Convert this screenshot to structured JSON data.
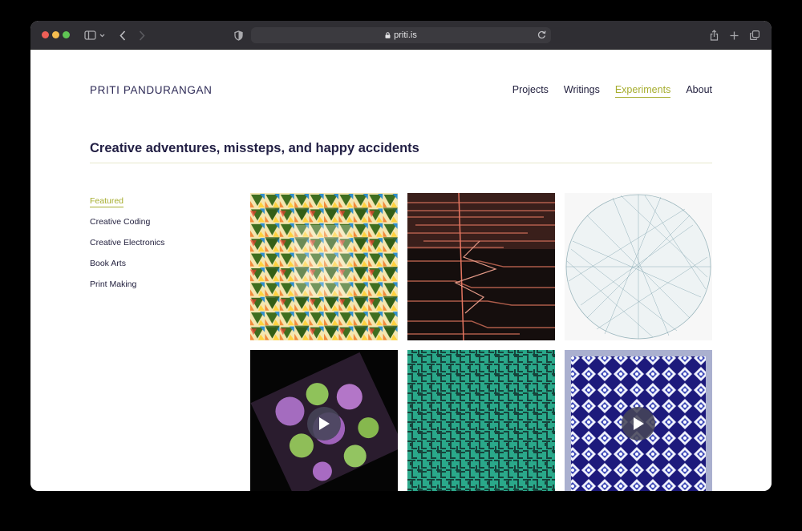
{
  "browser": {
    "url": "priti.is",
    "icons": [
      "sidebar-toggle-icon",
      "back-icon",
      "forward-icon",
      "shield-icon",
      "lock-icon",
      "reload-icon",
      "share-icon",
      "new-tab-icon",
      "tabs-overview-icon"
    ]
  },
  "site": {
    "brand": "PRITI PANDURANGAN",
    "nav": [
      {
        "label": "Projects"
      },
      {
        "label": "Writings"
      },
      {
        "label": "Experiments"
      },
      {
        "label": "About"
      }
    ],
    "active_nav": "Experiments",
    "heading": "Creative adventures, missteps, and happy accidents",
    "categories": [
      {
        "label": "Featured"
      },
      {
        "label": "Creative Coding"
      },
      {
        "label": "Creative Electronics"
      },
      {
        "label": "Book Arts"
      },
      {
        "label": "Print Making"
      }
    ],
    "active_category": "Featured"
  },
  "gallery": [
    {
      "name": "triangle-pattern",
      "video": false
    },
    {
      "name": "red-lines-terrain",
      "video": false
    },
    {
      "name": "string-circle",
      "video": false
    },
    {
      "name": "fractal-spheres",
      "video": true
    },
    {
      "name": "green-maze",
      "video": false
    },
    {
      "name": "blue-tiles",
      "video": true
    }
  ],
  "colors": {
    "accent": "#a6ad2e",
    "text_dark": "#221f44",
    "toolbar": "#2f2e33"
  }
}
